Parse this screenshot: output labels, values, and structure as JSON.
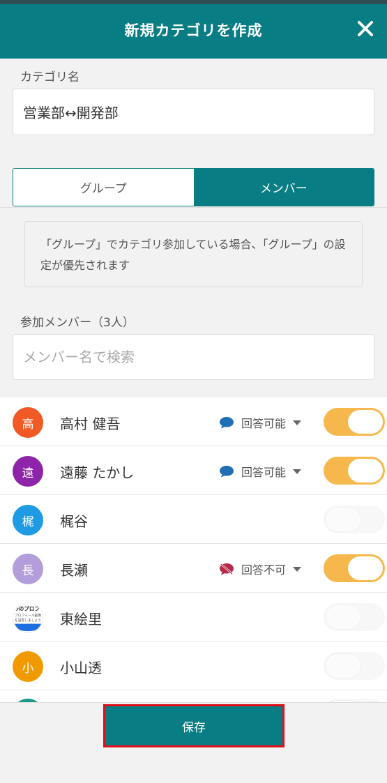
{
  "header": {
    "title": "新規カテゴリを作成"
  },
  "category": {
    "label": "カテゴリ名",
    "value": "営業部↔開発部"
  },
  "tabs": [
    {
      "label": "グループ",
      "active": false
    },
    {
      "label": "メンバー",
      "active": true
    }
  ],
  "notice": {
    "text": "「グループ」でカテゴリ参加している場合、「グループ」の設定が優先されます"
  },
  "members": {
    "label": "参加メンバー（3人）",
    "search_placeholder": "メンバー名で検索",
    "items": [
      {
        "initial": "高",
        "name": "高村 健吾",
        "color": "#f15a24",
        "permission": "回答可能",
        "permission_icon": "chat-bubble-icon",
        "enabled": true
      },
      {
        "initial": "遠",
        "name": "遠藤 たかし",
        "color": "#8e24aa",
        "permission": "回答可能",
        "permission_icon": "chat-bubble-icon",
        "enabled": true
      },
      {
        "initial": "梶",
        "name": "梶谷",
        "color": "#1e9be3",
        "permission": "",
        "enabled": false
      },
      {
        "initial": "長",
        "name": "長瀬",
        "color": "#b39ddb",
        "permission": "回答不可",
        "permission_icon": "chat-off-icon",
        "enabled": true
      },
      {
        "initial": "",
        "name": "東絵里",
        "avatar_image": "profile-photo",
        "photo_text": {
          "line1": "ｼのプロフ",
          "line2": "プロフィール画像",
          "line3": "を設定しましょう"
        },
        "permission": "",
        "enabled": false
      },
      {
        "initial": "小",
        "name": "小山透",
        "color": "#f09a00",
        "permission": "",
        "enabled": false
      }
    ]
  },
  "footer": {
    "save_label": "保存"
  },
  "colors": {
    "primary": "#087d84",
    "toggle_on": "#f6b84d",
    "highlight_border": "#e0101a"
  }
}
